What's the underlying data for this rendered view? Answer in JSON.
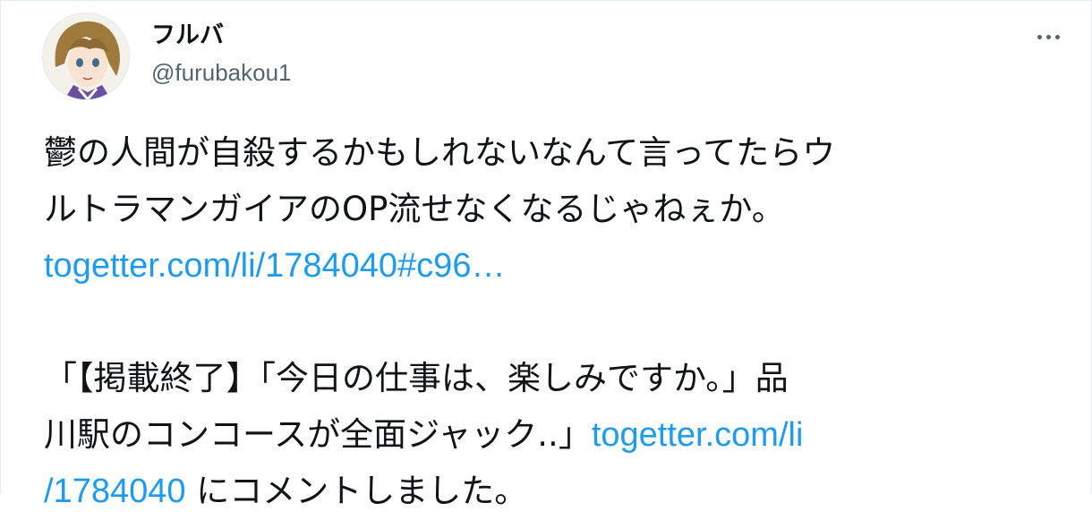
{
  "tweet": {
    "display_name": "フルバ",
    "handle": "@furubakou1",
    "avatar_icon": "user-avatar-illustration",
    "more_icon": "more-horizontal-icon",
    "line1": "鬱の人間が自殺するかもしれないなんて言ってたらウ",
    "line2": "ルトラマンガイアのOP流せなくなるじゃねぇか。",
    "link1": "togetter.com/li/1784040#c96…",
    "line3": "「【掲載終了】「今日の仕事は、楽しみですか。」品",
    "line4_text": "川駅のコンコースが全面ジャック..」",
    "link2_part1": "togetter.com/li",
    "link2_part2": "/1784040",
    "line5_text": " にコメントしました。"
  },
  "colors": {
    "link": "#1d9bf0",
    "text": "#0f1419",
    "secondary": "#536471"
  }
}
